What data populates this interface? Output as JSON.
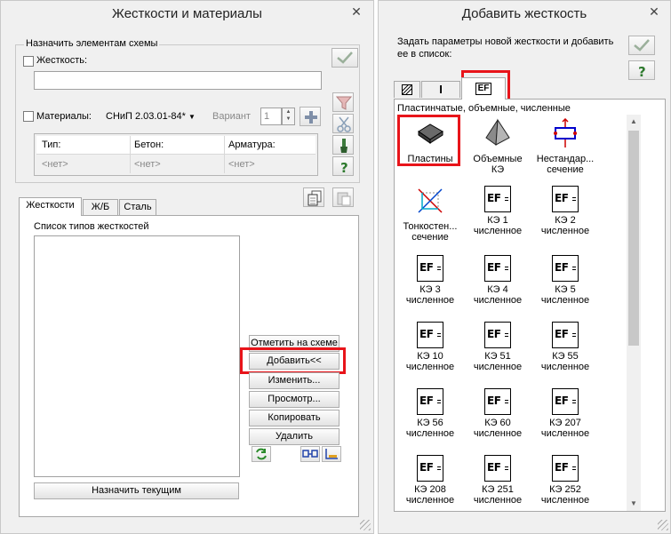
{
  "left_window": {
    "title": "Жесткости и материалы",
    "close_glyph": "✕",
    "assign_group_label": "Назначить элементам схемы",
    "stiffness_label": "Жесткость:",
    "stiffness_value": "",
    "materials_label": "Материалы:",
    "norm_value": "СНиП 2.03.01-84*",
    "variant_label": "Вариант",
    "variant_value": "1",
    "materials_table": {
      "headers": [
        "Тип:",
        "Бетон:",
        "Арматура:"
      ],
      "values": [
        "<нет>",
        "<нет>",
        "<нет>"
      ]
    },
    "tabs": [
      "Жесткости",
      "Ж/Б",
      "Сталь"
    ],
    "list_label": "Список типов жесткостей",
    "buttons": {
      "mark": "Отметить на схеме",
      "add": "Добавить<<",
      "edit": "Изменить...",
      "view": "Просмотр...",
      "copy": "Копировать",
      "delete": "Удалить",
      "assign_current": "Назначить текущим"
    }
  },
  "right_window": {
    "title": "Добавить жесткость",
    "close_glyph": "✕",
    "description": "Задать параметры новой жесткости и добавить ее в список:",
    "tab3_label": "EF",
    "tab2_label": "I",
    "group_label": "Пластинчатые, объемные, численные",
    "ef_glyph": "EF",
    "items": [
      {
        "line1": "Пластины",
        "line2": ""
      },
      {
        "line1": "Объемные",
        "line2": "КЭ"
      },
      {
        "line1": "Нестандар...",
        "line2": "сечение"
      },
      {
        "line1": "Тонкостен...",
        "line2": "сечение"
      },
      {
        "line1": "КЭ 1",
        "line2": "численное"
      },
      {
        "line1": "КЭ 2",
        "line2": "численное"
      },
      {
        "line1": "КЭ 3",
        "line2": "численное"
      },
      {
        "line1": "КЭ 4",
        "line2": "численное"
      },
      {
        "line1": "КЭ 5",
        "line2": "численное"
      },
      {
        "line1": "КЭ 10",
        "line2": "численное"
      },
      {
        "line1": "КЭ 51",
        "line2": "численное"
      },
      {
        "line1": "КЭ 55",
        "line2": "численное"
      },
      {
        "line1": "КЭ 56",
        "line2": "численное"
      },
      {
        "line1": "КЭ 60",
        "line2": "численное"
      },
      {
        "line1": "КЭ 207",
        "line2": "численное"
      },
      {
        "line1": "КЭ 208",
        "line2": "численное"
      },
      {
        "line1": "КЭ 251",
        "line2": "численное"
      },
      {
        "line1": "КЭ 252",
        "line2": "численное"
      }
    ]
  }
}
